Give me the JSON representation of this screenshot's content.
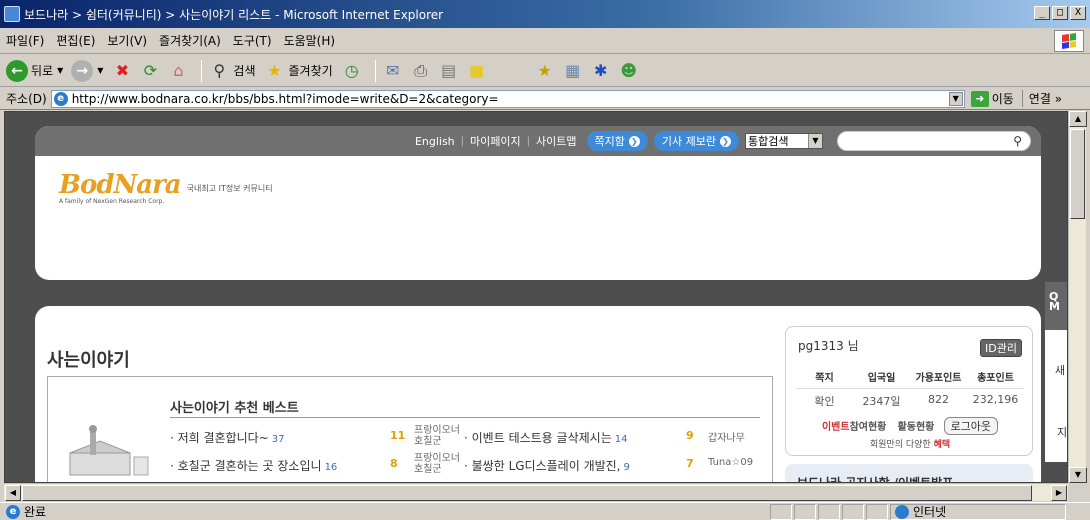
{
  "window": {
    "title": "보드나라 > 쉼터(커뮤니티) > 사는이야기 리스트 - Microsoft Internet Explorer",
    "controls": [
      "_",
      "□",
      "X"
    ]
  },
  "menu": [
    "파일(F)",
    "편집(E)",
    "보기(V)",
    "즐겨찾기(A)",
    "도구(T)",
    "도움말(H)"
  ],
  "toolbar": {
    "back_label": "뒤로",
    "search_label": "검색",
    "favorites_label": "즐겨찾기"
  },
  "address": {
    "label": "주소(D)",
    "url": "http://www.bodnara.co.kr/bbs/bbs.html?imode=write&D=2&category=",
    "go_label": "이동",
    "links_label": "연결"
  },
  "site_header": {
    "links": [
      "English",
      "마이페이지",
      "사이트맵"
    ],
    "memo_button": "쪽지함",
    "report_button": "기사 제보란",
    "search_scope": "통합검색",
    "search_value": "",
    "logo_text": "BodNara",
    "logo_tagline": "국내최고 IT정보 커뮤니티",
    "logo_sub": "A family of NexGen Research Corp."
  },
  "page": {
    "title": "사는이야기",
    "best_title": "사는이야기 추천 베스트",
    "best_rows": [
      {
        "title": "· 저희 결혼합니다~",
        "count": "37",
        "rank": "11",
        "author": "프랑이오너 호칠군",
        "title2": "· 이벤트 테스트용 글삭제시는",
        "count2": "14",
        "rank2": "9",
        "author2": "갑자나무"
      },
      {
        "title": "· 호칠군 결혼하는 곳 장소입니",
        "count": "16",
        "rank": "8",
        "author": "프랑이오너 호칠군",
        "title2": "· 불쌍한 LG디스플레이 개발진,",
        "count2": "9",
        "rank2": "7",
        "author2": "Tuna☆09"
      }
    ]
  },
  "user": {
    "name": "pg1313 님",
    "id_manage": "ID관리",
    "stats_headers": [
      "쪽지",
      "입국일",
      "가용포인트",
      "총포인트"
    ],
    "stats_values": [
      "확인",
      "2347일",
      "822",
      "232,196"
    ],
    "event_link_red": "이벤트",
    "event_link_rest": "참여현황",
    "activity_link": "활동현황",
    "logout": "로그아웃",
    "benefit_text": "회원만의 다양한",
    "benefit_red": "혜택"
  },
  "notice_title": "보드나라 공지사항 /이벤트발표",
  "right_tab": {
    "dark_text": "Q M",
    "t1": "새",
    "t2": "지"
  },
  "status": {
    "text": "완료",
    "zone": "인터넷"
  }
}
